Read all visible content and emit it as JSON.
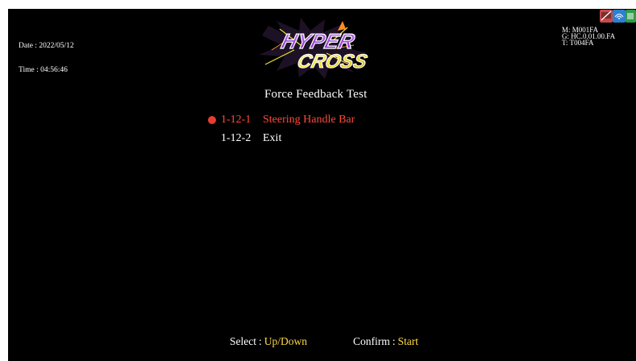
{
  "header": {
    "date_line": "Date : 2022/05/12",
    "time_line": "Time : 04:56:46",
    "machine_id": "M: M001FA",
    "game_version": "G: HC.0.01.00.FA",
    "terminal_id": "T: T004FA"
  },
  "logo": {
    "text": "HYPER CROSS",
    "top_word": "HYPER",
    "bottom_word": "CROSS",
    "colors": {
      "purple": "#9d3edb",
      "yellow": "#f2df35",
      "outline": "#ffffff"
    }
  },
  "status_icons": [
    {
      "name": "network-disconnected-icon",
      "color": "#c54a4a"
    },
    {
      "name": "ir-sensor-icon",
      "color": "#2c7fd3"
    },
    {
      "name": "status-green-icon",
      "color": "#2f9b49"
    }
  ],
  "menu": {
    "title": "Force Feedback Test",
    "items": [
      {
        "code": "1-12-1",
        "label": "Steering Handle Bar",
        "selected": true
      },
      {
        "code": "1-12-2",
        "label": "Exit",
        "selected": false
      }
    ]
  },
  "footer": {
    "select_label": "Select",
    "select_key": "Up/Down",
    "confirm_label": "Confirm",
    "confirm_key": "Start"
  },
  "colors": {
    "background": "#000000",
    "text": "#ffffff",
    "selected": "#ff4a3a",
    "accent_key": "#ffd944"
  }
}
